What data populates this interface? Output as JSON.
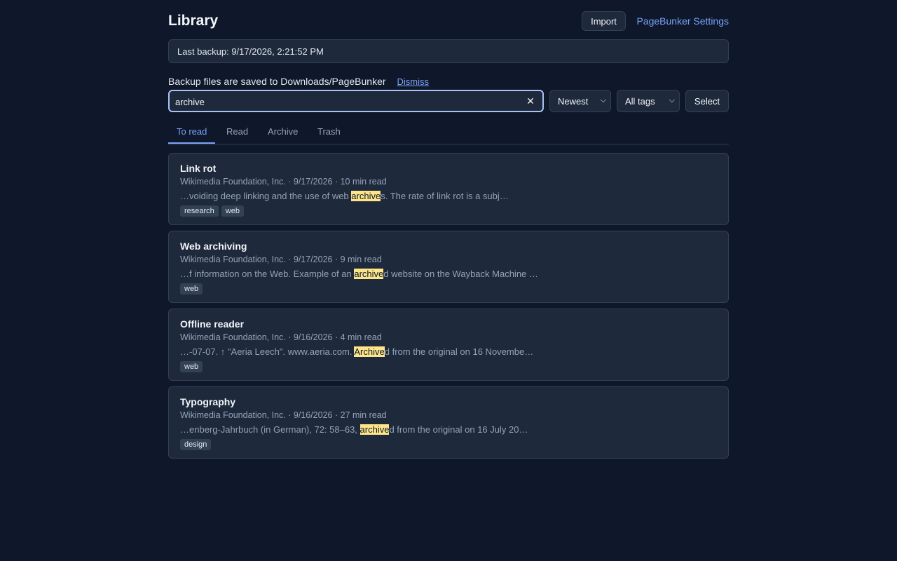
{
  "header": {
    "title": "Library",
    "import_label": "Import",
    "settings_label": "PageBunker Settings"
  },
  "backup": {
    "status": "Last backup: 9/17/2026, 2:21:52 PM"
  },
  "notice": {
    "text": "Backup files are saved to Downloads/PageBunker",
    "dismiss_label": "Dismiss"
  },
  "search": {
    "value": "archive",
    "clear_icon": "close-icon"
  },
  "filters": {
    "sort_selected": "Newest",
    "tags_selected": "All tags",
    "select_label": "Select"
  },
  "tabs": [
    {
      "label": "To read",
      "active": true
    },
    {
      "label": "Read",
      "active": false
    },
    {
      "label": "Archive",
      "active": false
    },
    {
      "label": "Trash",
      "active": false
    }
  ],
  "articles": [
    {
      "title": "Link rot",
      "meta": "Wikimedia Foundation, Inc. · 9/17/2026 · 10 min read",
      "snippet_before": "…voiding deep linking and the use of web ",
      "snippet_match": "archive",
      "snippet_after": "s. The rate of link rot is a subj…",
      "tags": [
        "research",
        "web"
      ]
    },
    {
      "title": "Web archiving",
      "meta": "Wikimedia Foundation, Inc. · 9/17/2026 · 9 min read",
      "snippet_before": "…f information on the Web. Example of an ",
      "snippet_match": "archive",
      "snippet_after": "d website on the Wayback Machine …",
      "tags": [
        "web"
      ]
    },
    {
      "title": "Offline reader",
      "meta": "Wikimedia Foundation, Inc. · 9/16/2026 · 4 min read",
      "snippet_before": "…-07-07. ↑ \"Aeria Leech\". www.aeria.com. ",
      "snippet_match": "Archive",
      "snippet_after": "d from the original on 16 Novembe…",
      "tags": [
        "web"
      ]
    },
    {
      "title": "Typography",
      "meta": "Wikimedia Foundation, Inc. · 9/16/2026 · 27 min read",
      "snippet_before": "…enberg-Jahrbuch (in German), 72: 58–63, ",
      "snippet_match": "archive",
      "snippet_after": "d from the original on 16 July 20…",
      "tags": [
        "design"
      ]
    }
  ],
  "colors": {
    "background": "#0f172a",
    "accent": "#7aa2f7",
    "highlight": "#fde68a"
  }
}
